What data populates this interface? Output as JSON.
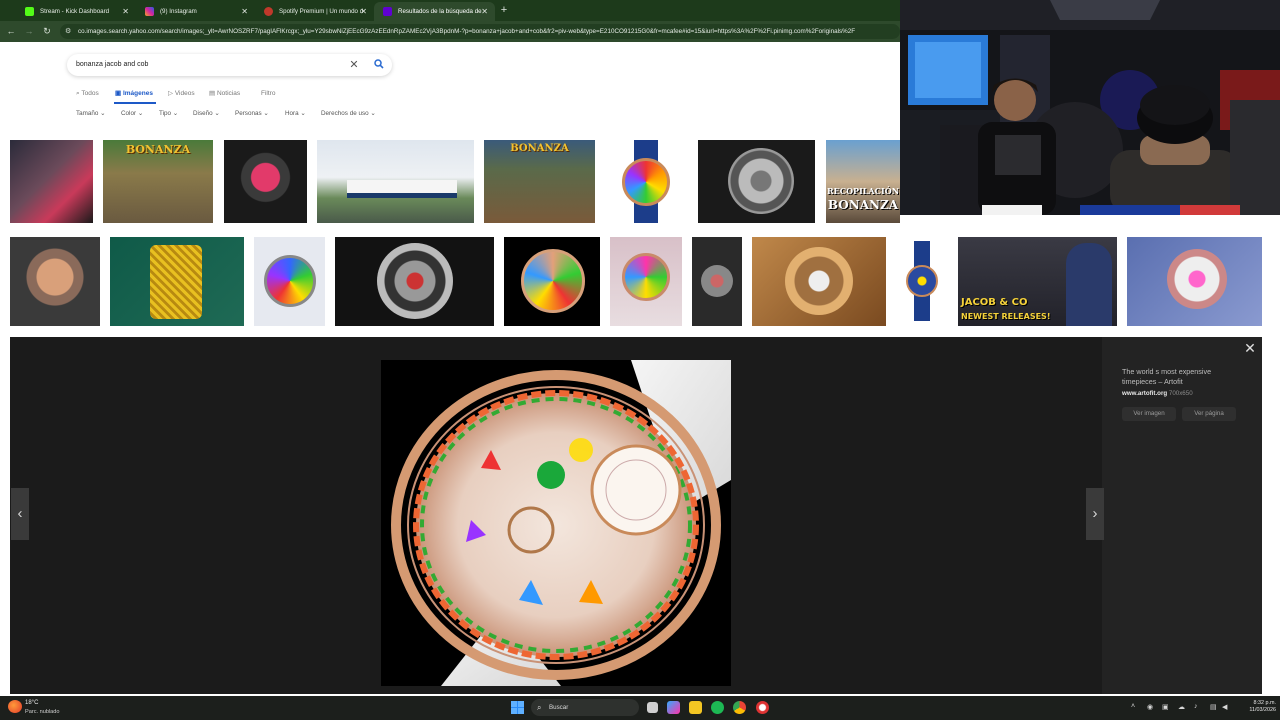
{
  "browser": {
    "tabs": [
      {
        "label": "Stream - Kick Dashboard",
        "active": false
      },
      {
        "label": "(9) Instagram",
        "active": false
      },
      {
        "label": "Spotify Premium | Un mundo d",
        "active": false
      },
      {
        "label": "Resultados de la búsqueda de",
        "active": true
      }
    ],
    "url": "co.images.search.yahoo.com/search/images;_ylt=AwrNOSZRF7/pagIAFlKrcgx;_ylu=Y29sbwNiZjEEcG9zAzEEdnRpZAMEc2VjA3BpdnM-?p=bonanza+jacob+and+cob&fr2=piv-web&type=E210CO91215G0&fr=mcafee#id=15&iurl=https%3A%2F%2Fi.pinimg.com%2Foriginals%2F"
  },
  "search": {
    "query": "bonanza jacob and cob",
    "verticals": [
      "Todos",
      "Imágenes",
      "Videos",
      "Noticias",
      "Filtro"
    ],
    "active_vertical": "Imágenes",
    "filters": [
      "Tamaño",
      "Color",
      "Tipo",
      "Diseño",
      "Personas",
      "Hora",
      "Derechos de uso"
    ]
  },
  "thumbnails": {
    "row1_texts": [
      "BONANZA",
      "BONANZA",
      "RECOPILACIÓN",
      "BONANZA"
    ],
    "row2_texts": [
      "JACOB & CO",
      "NEWEST RELEASES!"
    ]
  },
  "preview": {
    "title": "The world s most expensive timepieces – Artofit",
    "source": "www.artofit.org",
    "dimensions": "700x650",
    "buttons": [
      "Ver imagen",
      "Ver página"
    ]
  },
  "taskbar": {
    "temperature": "18°C",
    "weather": "Parc. nublado",
    "search_label": "Buscar",
    "time": "8:32 p.m.",
    "date": "11/03/2026"
  },
  "colors": {
    "browser_frame": "#1d3a1b",
    "yahoo_blue": "#1d59c7",
    "preview_bg": "#1b1b1b"
  }
}
